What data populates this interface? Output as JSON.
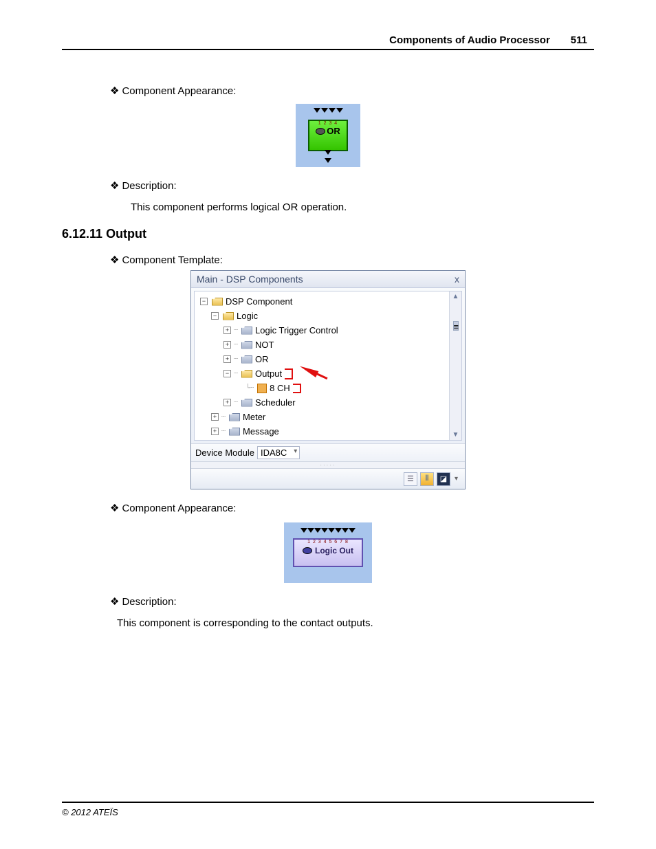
{
  "header": {
    "title": "Components of Audio Processor",
    "page": "511"
  },
  "labels": {
    "appearance": "Component Appearance:",
    "description": "Description:",
    "template": "Component Template:"
  },
  "or_component": {
    "pins": "1 2 3 4",
    "text": "OR",
    "description": "This component performs logical OR operation."
  },
  "section_heading": "6.12.11 Output",
  "tree": {
    "title": "Main - DSP Components",
    "close": "x",
    "root": "DSP Component",
    "logic": "Logic",
    "items": {
      "ltc": "Logic Trigger Control",
      "not": "NOT",
      "or": "OR",
      "output": "Output",
      "eight_ch": "8 CH",
      "scheduler": "Scheduler",
      "meter": "Meter",
      "message": "Message"
    },
    "device_label": "Device Module",
    "device_value": "IDA8C"
  },
  "logic_out": {
    "pins": "1 2 3 4 5 6 7 8",
    "text": "Logic Out",
    "description": "This component is corresponding to the contact outputs."
  },
  "footer": "© 2012 ATEÏS"
}
